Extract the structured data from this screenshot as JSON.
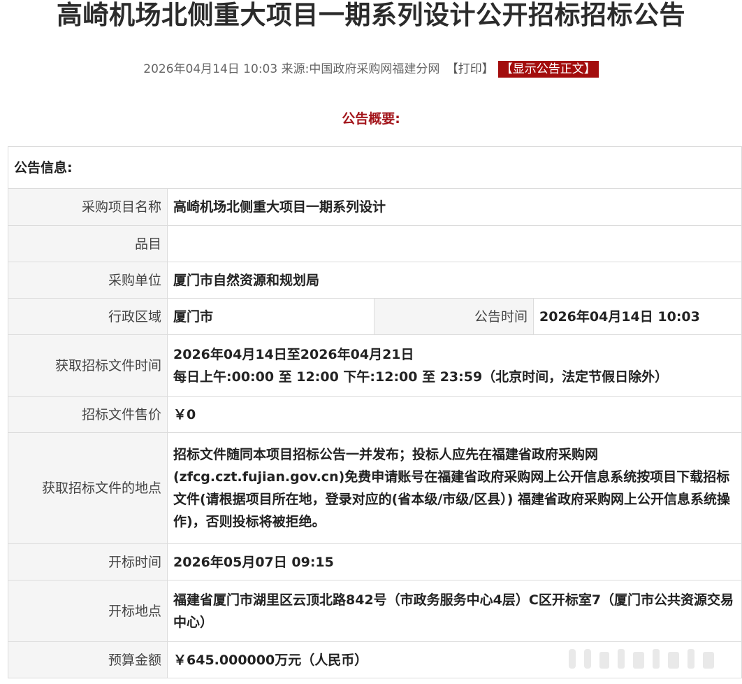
{
  "title": "高崎机场北侧重大项目一期系列设计公开招标招标公告",
  "meta": {
    "datetime": "2026年04月14日 10:03",
    "source_label": "来源:",
    "source": "中国政府采购网福建分网",
    "print": "【打印】",
    "show_body": "【显示公告正文】"
  },
  "summary_heading": "公告概要:",
  "info_heading": "公告信息:",
  "rows": {
    "project_name": {
      "label": "采购项目名称",
      "value": "高崎机场北侧重大项目一期系列设计"
    },
    "category": {
      "label": "品目",
      "value": ""
    },
    "purchaser": {
      "label": "采购单位",
      "value": "厦门市自然资源和规划局"
    },
    "region": {
      "label": "行政区域",
      "value": "厦门市"
    },
    "notice_time": {
      "label": "公告时间",
      "value": "2026年04月14日 10:03"
    },
    "doc_time": {
      "label": "获取招标文件时间",
      "line1": "2026年04月14日至2026年04月21日",
      "line2": "每日上午:00:00 至 12:00  下午:12:00 至 23:59（北京时间，法定节假日除外）"
    },
    "doc_price": {
      "label": "招标文件售价",
      "value": "￥0"
    },
    "doc_place": {
      "label": "获取招标文件的地点",
      "value": "招标文件随同本项目招标公告一并发布；投标人应先在福建省政府采购网(zfcg.czt.fujian.gov.cn)免费申请账号在福建省政府采购网上公开信息系统按项目下载招标文件(请根据项目所在地，登录对应的(省本级/市级/区县）) 福建省政府采购网上公开信息系统操作)，否则投标将被拒绝。"
    },
    "open_time": {
      "label": "开标时间",
      "value": "2026年05月07日 09:15"
    },
    "open_place": {
      "label": "开标地点",
      "value": "福建省厦门市湖里区云顶北路842号（市政务服务中心4层）C区开标室7（厦门市公共资源交易中心）"
    },
    "budget": {
      "label": "预算金额",
      "value": "￥645.000000万元（人民币）"
    }
  }
}
